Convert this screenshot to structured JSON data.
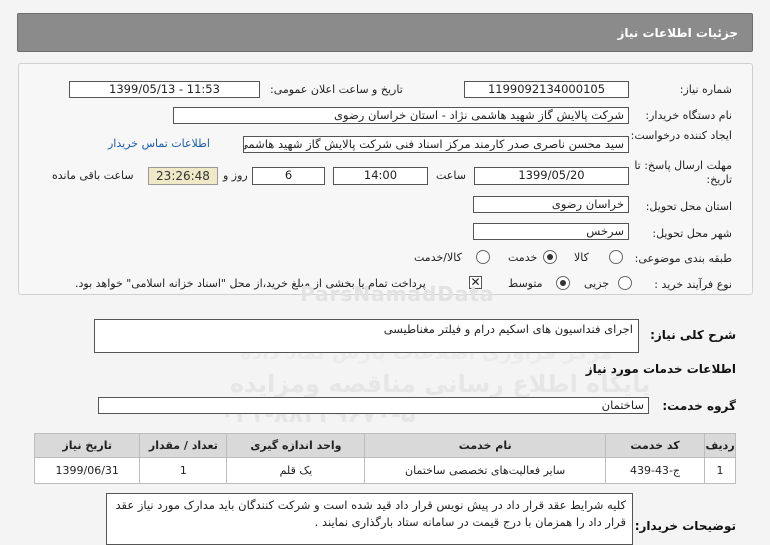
{
  "header": {
    "title": "جزئیات اطلاعات نیاز"
  },
  "fields": {
    "need_number_label": "شماره نیاز:",
    "need_number": "1199092134000105",
    "announce_label": "تاریخ و ساعت اعلان عمومی:",
    "announce_value": "1399/05/13 - 11:53",
    "buyer_org_label": "نام دستگاه خریدار:",
    "buyer_org": "شرکت پالایش گاز شهید هاشمی نژاد - استان خراسان رضوی",
    "creator_label": "ایجاد کننده درخواست:",
    "creator": "سید محسن  ناصری صدر کارمند مرکز اسناد فنی شرکت پالایش گاز شهید هاشمی نژاد",
    "contact_link": "اطلاعات تماس خریدار",
    "deadline_label": "مهلت ارسال پاسخ: تا تاریخ:",
    "deadline_date": "1399/05/20",
    "time_label": "ساعت",
    "deadline_time": "14:00",
    "days_value": "6",
    "days_label": "روز و",
    "countdown": "23:26:48",
    "remaining_label": "ساعت باقی مانده",
    "province_label": "استان محل تحویل:",
    "province": "خراسان رضوی",
    "city_label": "شهر محل تحویل:",
    "city": "سرخس",
    "category_label": "طبقه بندی موضوعی:",
    "category_options": [
      "کالا",
      "خدمت",
      "کالا/خدمت"
    ],
    "category_selected": "خدمت",
    "process_label": "نوع فرآیند خرید :",
    "process_options": [
      "جزیی",
      "متوسط"
    ],
    "process_selected": "متوسط",
    "payment_note": "پرداخت تمام یا بخشی از مبلغ خرید،از محل \"اسناد خزانه اسلامی\" خواهد بود."
  },
  "description": {
    "label": "شرح کلی نیاز:",
    "value": "اجرای فنداسیون های اسکیم درام و فیلتر مغناطیسی"
  },
  "services_heading": "اطلاعات خدمات مورد نیاز",
  "service_group": {
    "label": "گروه خدمت:",
    "value": "ساختمان"
  },
  "table": {
    "headers": [
      "ردیف",
      "کد خدمت",
      "نام خدمت",
      "واحد اندازه گیری",
      "تعداد / مقدار",
      "تاریخ نیاز"
    ],
    "rows": [
      [
        "1",
        "ج-43-439",
        "سایر فعالیت‌های تخصصی ساختمان",
        "یک قلم",
        "1",
        "1399/06/31"
      ]
    ]
  },
  "buyer_notes": {
    "label": "توضیحات خریدار:",
    "value": "کلیه شرایط عقد قرار داد در پیش نویس قرار داد قید شده است و شرکت کنندگان باید مدارک مورد نیاز عقد قرار داد را همزمان با درج قیمت در سامانه ستاد بارگذاری نمایند ."
  },
  "watermarks": [
    "ParsNamadData",
    "مرکز فراوری اطلاعات پارس نماد داده",
    "پایگاه اطلاع رسانی مناقصه ومزایده",
    "۰۲۱-۸۸۳۴۹۶۷۰-۵"
  ]
}
